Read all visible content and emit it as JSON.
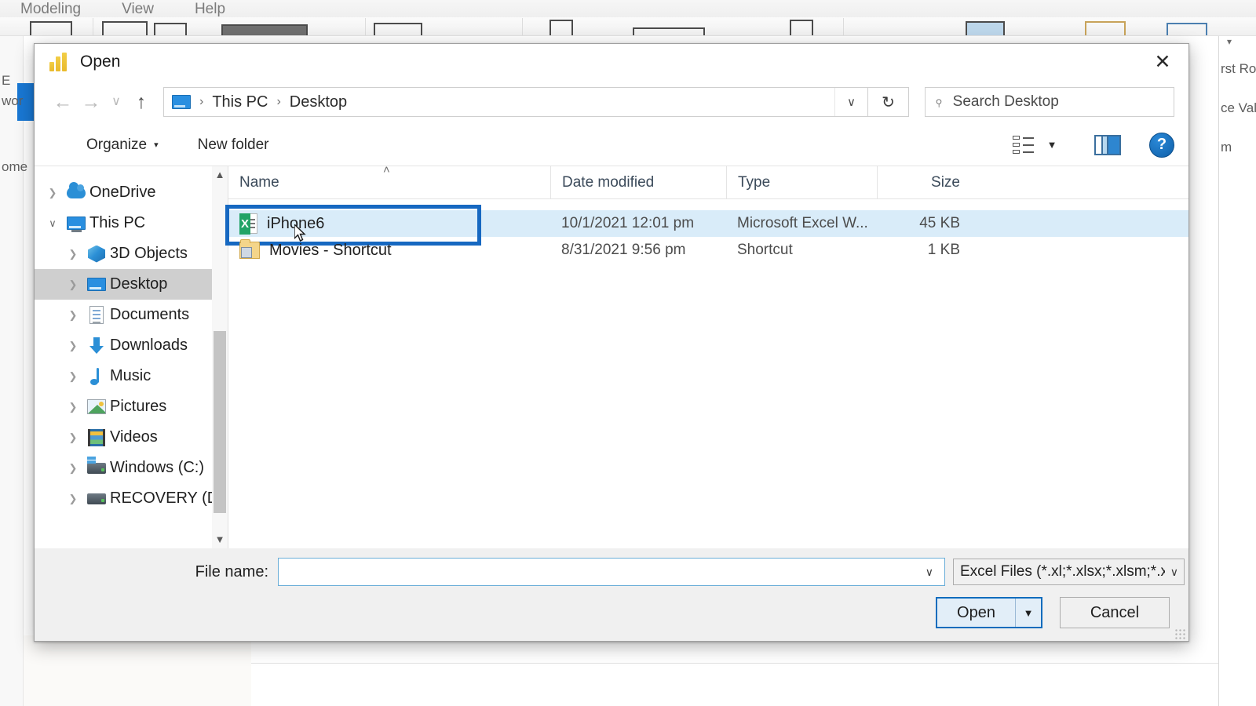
{
  "background_app": {
    "menu_items": [
      "Modeling",
      "View",
      "Help"
    ],
    "left_labels": [
      "E",
      "wor",
      "ome"
    ],
    "right_labels": [
      "rst Ro",
      "ce Val",
      "m"
    ],
    "accent_color": "#1978d4"
  },
  "dialog": {
    "title": "Open",
    "title_icon": "power-bi-icon",
    "close_icon": "close-icon",
    "nav": {
      "back_icon": "arrow-left-icon",
      "forward_icon": "arrow-right-icon",
      "recent_icon": "chevron-down-icon",
      "up_icon": "arrow-up-icon",
      "breadcrumb": {
        "root_icon": "monitor-icon",
        "items": [
          "This PC",
          "Desktop"
        ],
        "separator": "›",
        "dropdown_icon": "chevron-down-icon"
      },
      "refresh_icon": "refresh-icon",
      "search": {
        "icon": "search-icon",
        "placeholder": "Search Desktop",
        "value": ""
      }
    },
    "toolbar": {
      "organize_label": "Organize",
      "organize_caret": "▾",
      "new_folder_label": "New folder",
      "view_icon": "list-view-icon",
      "view_caret": "▾",
      "preview_pane_icon": "preview-pane-icon",
      "help_icon": "help-icon",
      "help_label": "?"
    },
    "sidebar": {
      "items": [
        {
          "label": "OneDrive",
          "icon": "onedrive-cloud-icon",
          "expandable": true,
          "expanded": false,
          "indent": false,
          "selected": false
        },
        {
          "label": "This PC",
          "icon": "monitor-icon",
          "expandable": true,
          "expanded": true,
          "indent": false,
          "selected": false
        },
        {
          "label": "3D Objects",
          "icon": "3d-objects-icon",
          "expandable": true,
          "expanded": false,
          "indent": true,
          "selected": false
        },
        {
          "label": "Desktop",
          "icon": "desktop-monitor-icon",
          "expandable": true,
          "expanded": false,
          "indent": true,
          "selected": true
        },
        {
          "label": "Documents",
          "icon": "documents-icon",
          "expandable": true,
          "expanded": false,
          "indent": true,
          "selected": false
        },
        {
          "label": "Downloads",
          "icon": "downloads-arrow-icon",
          "expandable": true,
          "expanded": false,
          "indent": true,
          "selected": false
        },
        {
          "label": "Music",
          "icon": "music-note-icon",
          "expandable": true,
          "expanded": false,
          "indent": true,
          "selected": false
        },
        {
          "label": "Pictures",
          "icon": "pictures-icon",
          "expandable": true,
          "expanded": false,
          "indent": true,
          "selected": false
        },
        {
          "label": "Videos",
          "icon": "videos-film-icon",
          "expandable": true,
          "expanded": false,
          "indent": true,
          "selected": false
        },
        {
          "label": "Windows (C:)",
          "icon": "windows-drive-icon",
          "expandable": true,
          "expanded": false,
          "indent": true,
          "selected": false
        },
        {
          "label": "RECOVERY (D:)",
          "icon": "drive-icon",
          "expandable": true,
          "expanded": false,
          "indent": true,
          "selected": false
        }
      ],
      "scrollbar": {
        "up_icon": "scroll-up-arrow-icon",
        "down_icon": "scroll-down-arrow-icon"
      }
    },
    "file_list": {
      "columns": [
        "Name",
        "Date modified",
        "Type",
        "Size"
      ],
      "sort_column": "Name",
      "sort_indicator": "˄",
      "rows": [
        {
          "name": "iPhone6",
          "icon": "excel-file-icon",
          "date_modified": "10/1/2021 12:01 pm",
          "type": "Microsoft Excel W...",
          "size": "45 KB",
          "selected": true,
          "highlighted": true
        },
        {
          "name": "Movies - Shortcut",
          "icon": "folder-shortcut-icon",
          "date_modified": "8/31/2021 9:56 pm",
          "type": "Shortcut",
          "size": "1 KB",
          "selected": false,
          "highlighted": false
        }
      ],
      "annotation_color": "#1668c1",
      "cursor_icon": "mouse-pointer-icon"
    },
    "footer": {
      "filename_label": "File name:",
      "filename_value": "",
      "filename_placeholder": "",
      "filename_caret": "∨",
      "filetype_value": "Excel Files (*.xl;*.xlsx;*.xlsm;*.xl",
      "filetype_caret": "∨",
      "open_label": "Open",
      "open_caret": "▼",
      "cancel_label": "Cancel"
    }
  }
}
